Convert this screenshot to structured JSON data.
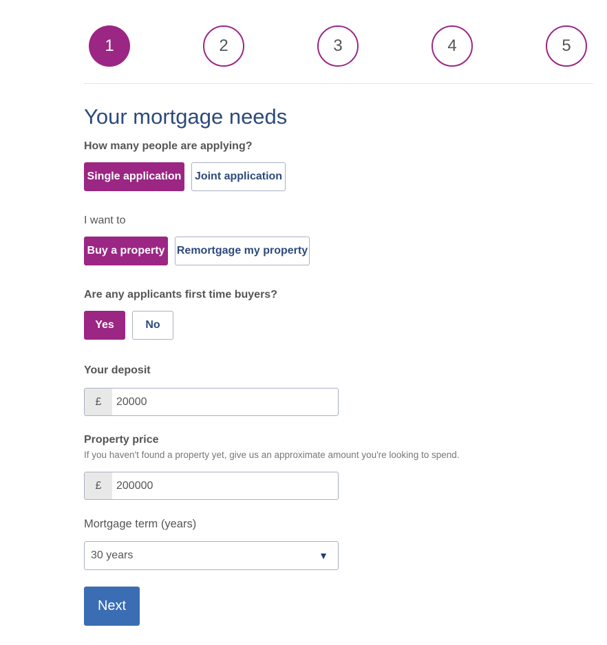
{
  "steps": [
    "1",
    "2",
    "3",
    "4",
    "5"
  ],
  "current_step": 1,
  "colors": {
    "accent": "#9b2683",
    "title": "#2d4a7c",
    "primary_button": "#3b6db4"
  },
  "title": "Your mortgage needs",
  "applicants": {
    "label": "How many people are applying?",
    "options": [
      "Single application",
      "Joint application"
    ],
    "selected": "Single application"
  },
  "intent": {
    "label": "I want to",
    "options": [
      "Buy a property",
      "Remortgage my property"
    ],
    "selected": "Buy a property"
  },
  "first_time": {
    "label": "Are any applicants first time buyers?",
    "options": [
      "Yes",
      "No"
    ],
    "selected": "Yes"
  },
  "deposit": {
    "label": "Your deposit",
    "prefix": "£",
    "value": "20000"
  },
  "price": {
    "label": "Property price",
    "help": "If you haven't found a property yet, give us an approximate amount you're looking to spend.",
    "prefix": "£",
    "value": "200000"
  },
  "term": {
    "label": "Mortgage term (years)",
    "value": "30 years",
    "icon": "triangle-down-icon"
  },
  "next_label": "Next"
}
